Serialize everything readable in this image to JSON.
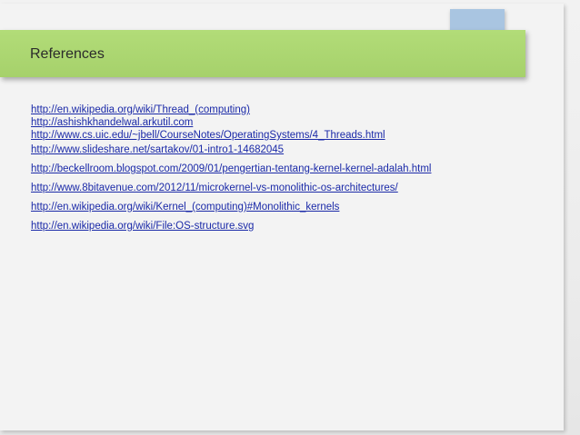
{
  "slide": {
    "title": "References",
    "references": [
      "http://en.wikipedia.org/wiki/Thread_(computing)",
      "http://ashishkhandelwal.arkutil.com",
      "http://www.cs.uic.edu/~jbell/CourseNotes/OperatingSystems/4_Threads.html",
      "http://www.slideshare.net/sartakov/01-intro1-14682045",
      "http://beckellroom.blogspot.com/2009/01/pengertian-tentang-kernel-kernel-adalah.html",
      "http://www.8bitavenue.com/2012/11/microkernel-vs-monolithic-os-architectures/",
      "http://en.wikipedia.org/wiki/Kernel_(computing)#Monolithic_kernels",
      "http://en.wikipedia.org/wiki/File:OS-structure.svg"
    ]
  },
  "colors": {
    "title_bar": "#a6d16b",
    "corner_square": "#a9c5e1",
    "link": "#1b2aa8"
  }
}
